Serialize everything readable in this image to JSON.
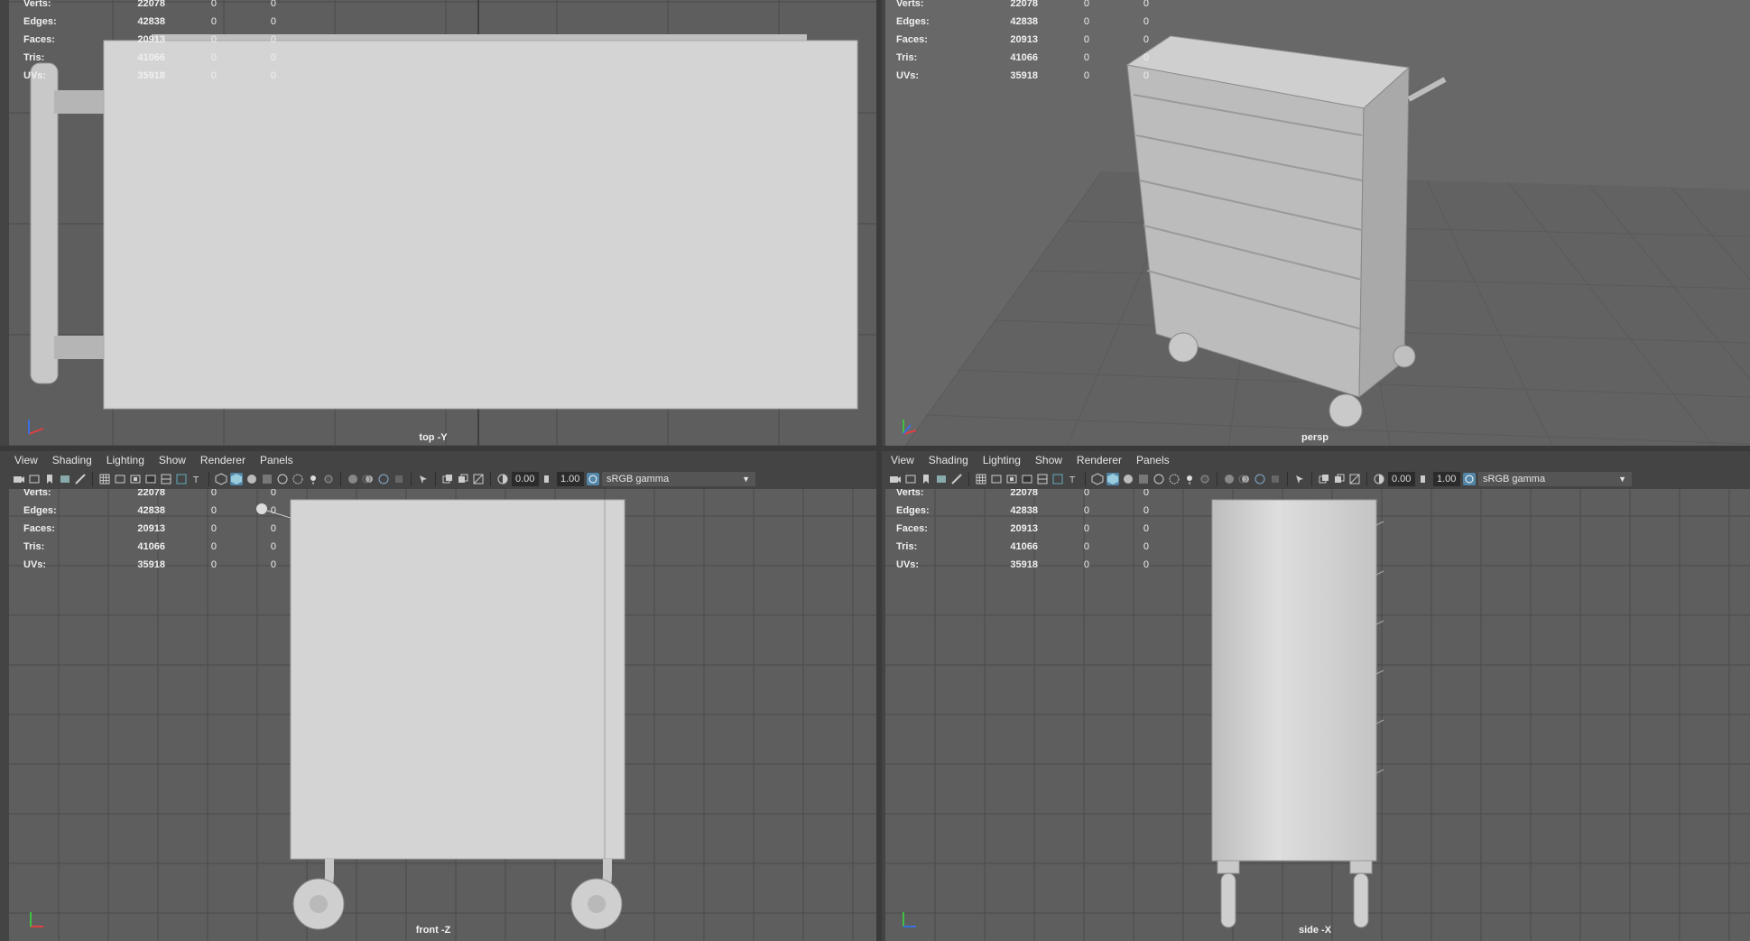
{
  "menus": [
    "View",
    "Shading",
    "Lighting",
    "Show",
    "Renderer",
    "Panels"
  ],
  "toolbar": {
    "exposure": "0.00",
    "gamma": "1.00",
    "color_space": "sRGB gamma"
  },
  "hud": {
    "rows": [
      {
        "label": "Verts:",
        "v1": "22078",
        "v2": "0",
        "v3": "0"
      },
      {
        "label": "Edges:",
        "v1": "42838",
        "v2": "0",
        "v3": "0"
      },
      {
        "label": "Faces:",
        "v1": "20913",
        "v2": "0",
        "v3": "0"
      },
      {
        "label": "Tris:",
        "v1": "41066",
        "v2": "0",
        "v3": "0"
      },
      {
        "label": "UVs:",
        "v1": "35918",
        "v2": "0",
        "v3": "0"
      }
    ]
  },
  "viewports": {
    "top": {
      "camera": "top -Y"
    },
    "persp": {
      "camera": "persp"
    },
    "front": {
      "camera": "front -Z"
    },
    "side": {
      "camera": "side -X"
    }
  },
  "axis_labels": {
    "x": "x",
    "y": "y",
    "z": "z"
  },
  "colors": {
    "accent": "#5285a6",
    "viewport_bg": "#5e5e5e",
    "model": "#d2d2d2",
    "grid": "#4c4c4c"
  }
}
